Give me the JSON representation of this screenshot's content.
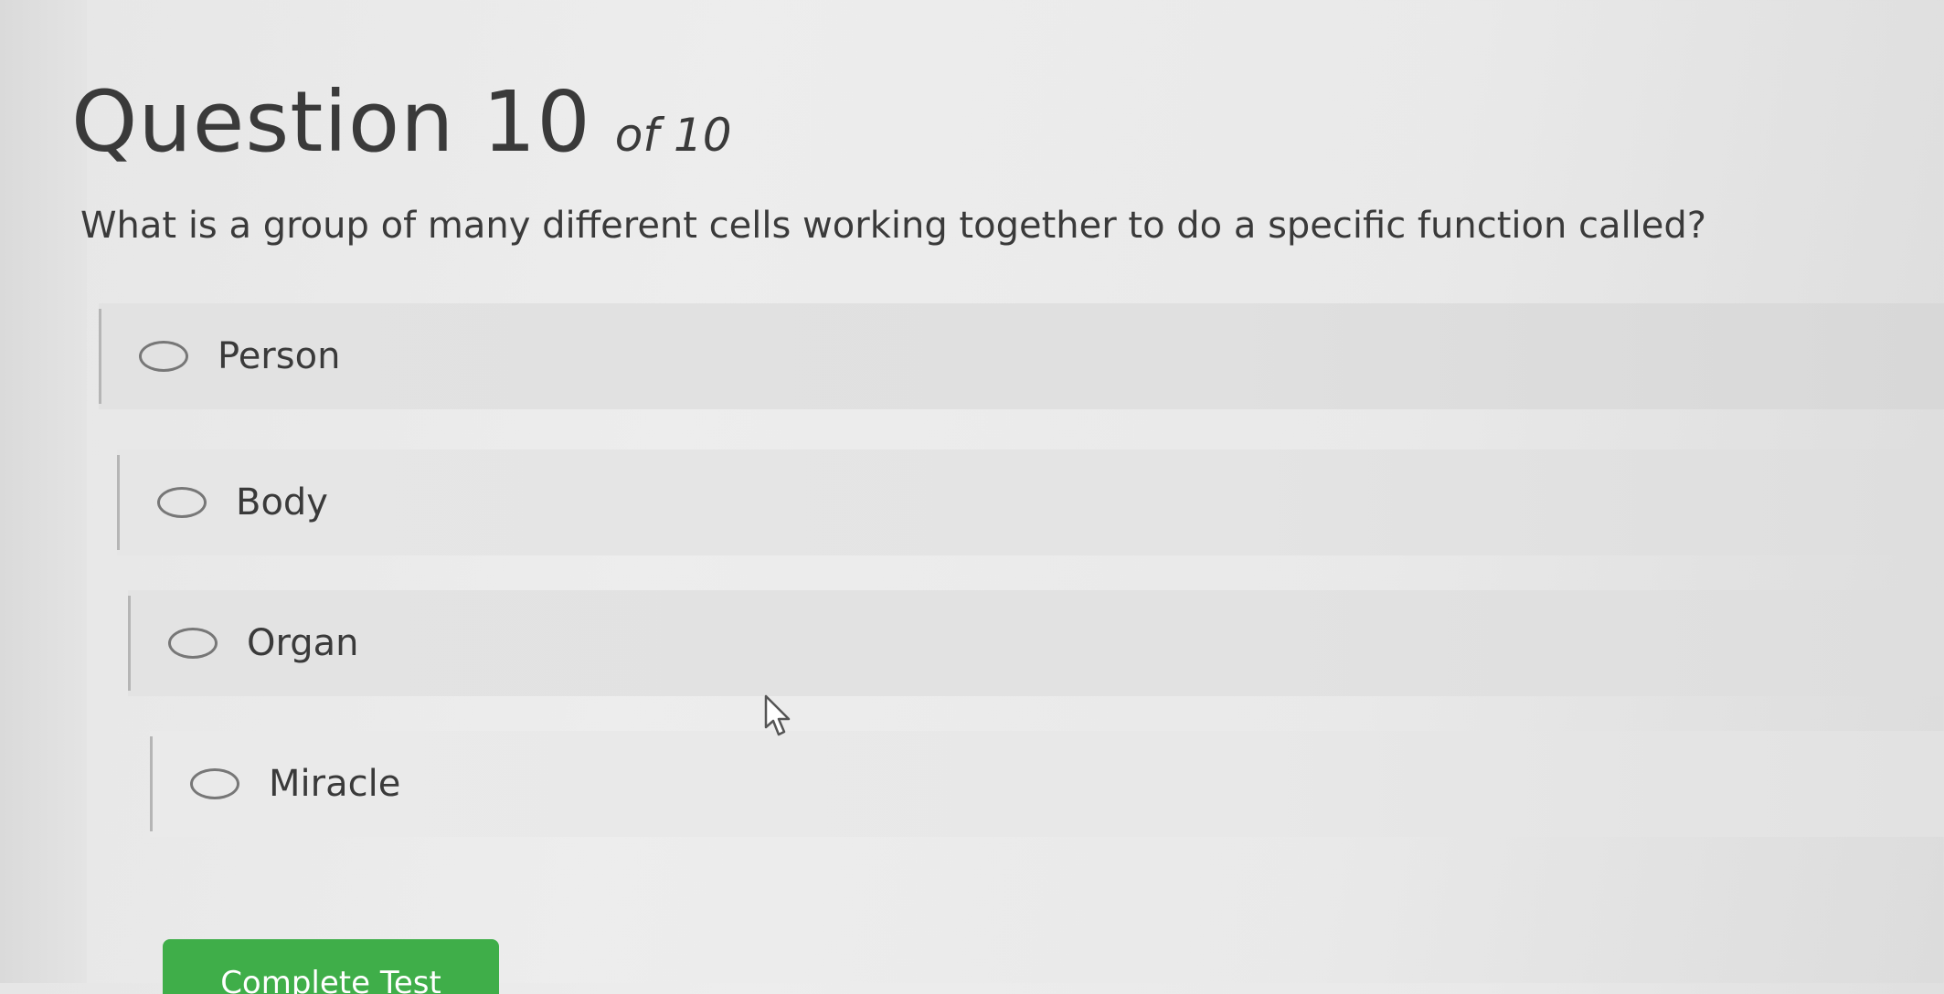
{
  "question": {
    "title": "Question 10",
    "count": "of 10",
    "text": "What is a group of many different cells working together to do a specific function called?"
  },
  "options": [
    {
      "label": "Person",
      "selected": false
    },
    {
      "label": "Body",
      "selected": false
    },
    {
      "label": "Organ",
      "selected": false
    },
    {
      "label": "Miracle",
      "selected": false
    }
  ],
  "submit": {
    "label": "Complete Test",
    "color": "#3fae49"
  },
  "icons": {
    "radio": "radio-button-icon",
    "cursor": "mouse-pointer-icon"
  }
}
